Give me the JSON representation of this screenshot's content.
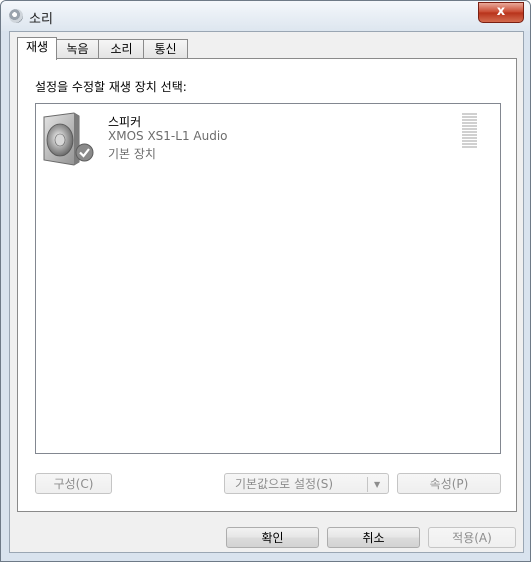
{
  "window": {
    "title": "소리",
    "close_label": "x"
  },
  "tabs": [
    {
      "label": "재생",
      "active": true
    },
    {
      "label": "녹음",
      "active": false
    },
    {
      "label": "소리",
      "active": false
    },
    {
      "label": "통신",
      "active": false
    }
  ],
  "panel": {
    "instruction": "설정을 수정할 재생 장치 선택:",
    "devices": [
      {
        "name": "스피커",
        "description": "XMOS XS1-L1 Audio",
        "status": "기본 장치",
        "icon": "speaker-icon",
        "default_check": true,
        "level_meter": {
          "segments": 12,
          "level": 0
        }
      }
    ],
    "buttons": {
      "configure": "구성(C)",
      "set_default": "기본값으로 설정(S)",
      "properties": "속성(P)"
    }
  },
  "footer": {
    "ok": "확인",
    "cancel": "취소",
    "apply": "적용(A)"
  },
  "colors": {
    "close_button": "#c7452c",
    "frame": "#d9e3ee",
    "disabled_text": "#8d8d8d"
  }
}
